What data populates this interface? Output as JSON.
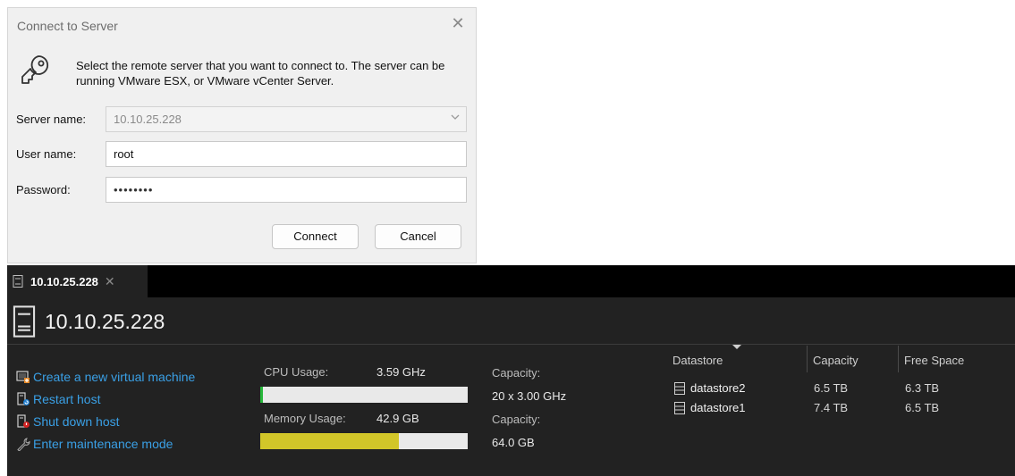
{
  "dialog": {
    "title": "Connect to Server",
    "close_glyph": "✕",
    "message": "Select the remote server that you want to connect to. The server can be running VMware ESX, or VMware vCenter Server.",
    "fields": {
      "server_label": "Server name:",
      "server_value": "10.10.25.228",
      "user_label": "User name:",
      "user_value": "root",
      "password_label": "Password:",
      "password_value": "••••••••"
    },
    "buttons": {
      "connect": "Connect",
      "cancel": "Cancel"
    },
    "icons": {
      "key": "key-icon",
      "combo": "chevron-down-icon"
    }
  },
  "host": {
    "tab": {
      "label": "10.10.25.228",
      "close_glyph": "✕"
    },
    "title": "10.10.25.228",
    "actions": [
      {
        "label": "Create a new virtual machine",
        "icon": "new-vm-icon"
      },
      {
        "label": "Restart host",
        "icon": "restart-host-icon"
      },
      {
        "label": "Shut down host",
        "icon": "shutdown-host-icon"
      },
      {
        "label": "Enter maintenance mode",
        "icon": "wrench-icon"
      }
    ],
    "cpu": {
      "label": "CPU Usage:",
      "value": "3.59 GHz",
      "fraction": 0.015,
      "color": "#27b73b"
    },
    "memory": {
      "label": "Memory Usage:",
      "value": "42.9 GB",
      "fraction": 0.67,
      "color": "#d2c629"
    },
    "capacity": {
      "label_1": "Capacity:",
      "cpu": "20 x 3.00 GHz",
      "label_2": "Capacity:",
      "memory": "64.0 GB"
    },
    "datastores": {
      "columns": [
        "Datastore",
        "Capacity",
        "Free Space"
      ],
      "rows": [
        {
          "name": "datastore2",
          "capacity": "6.5 TB",
          "free": "6.3 TB"
        },
        {
          "name": "datastore1",
          "capacity": "7.4 TB",
          "free": "6.5 TB"
        }
      ]
    }
  }
}
